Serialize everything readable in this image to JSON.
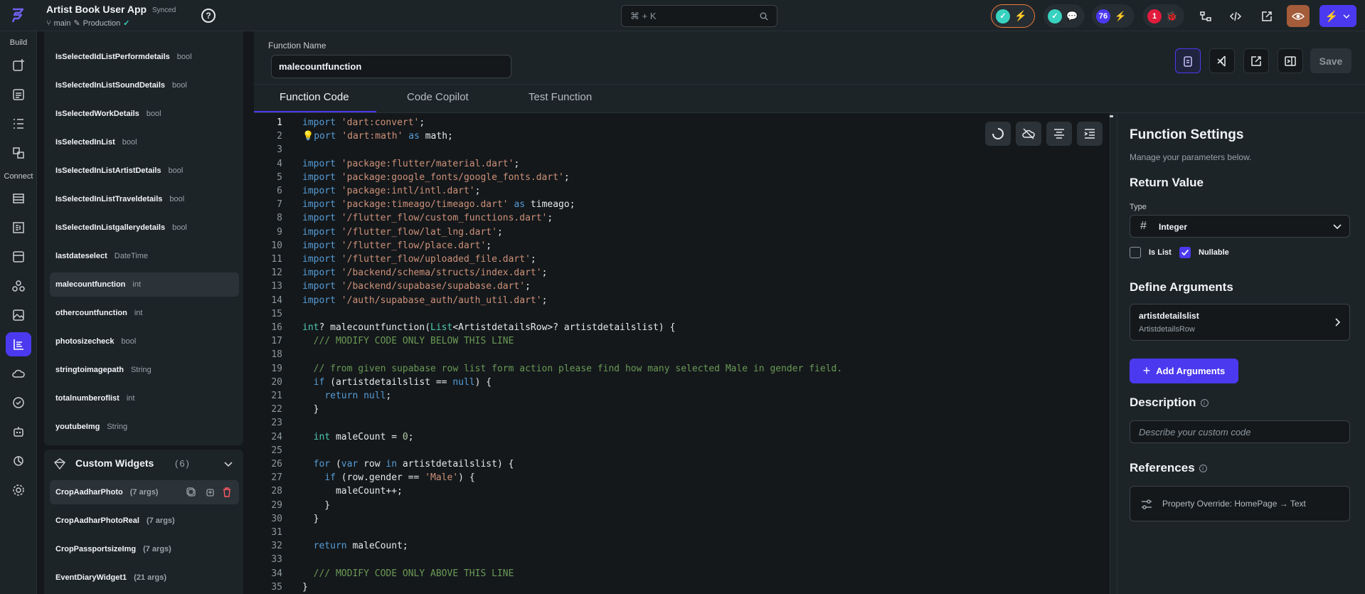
{
  "topbar": {
    "app_title": "Artist Book User App",
    "sync_status": "Synced",
    "branch": "main",
    "environment": "Production",
    "search_hint": "⌘ + K",
    "issue_count": "76",
    "error_count": "1"
  },
  "rail": {
    "build_label": "Build",
    "connect_label": "Connect"
  },
  "left_panel": {
    "items": [
      {
        "name": "IsSelectedIdListPerformdetails",
        "type": "bool"
      },
      {
        "name": "IsSelectedInListSoundDetails",
        "type": "bool"
      },
      {
        "name": "IsSelectedWorkDetails",
        "type": "bool"
      },
      {
        "name": "IsSelectedInList",
        "type": "bool"
      },
      {
        "name": "IsSelectedInListArtistDetails",
        "type": "bool"
      },
      {
        "name": "IsSelectedInListTraveldetails",
        "type": "bool"
      },
      {
        "name": "IsSelectedInListgallerydetails",
        "type": "bool"
      },
      {
        "name": "lastdateselect",
        "type": "DateTime"
      },
      {
        "name": "malecountfunction",
        "type": "int"
      },
      {
        "name": "othercountfunction",
        "type": "int"
      },
      {
        "name": "photosizecheck",
        "type": "bool"
      },
      {
        "name": "stringtoimagepath",
        "type": "String"
      },
      {
        "name": "totalnumberoflist",
        "type": "int"
      },
      {
        "name": "youtubeImg",
        "type": "String"
      }
    ],
    "widgets_title": "Custom Widgets",
    "widgets_count": "(6)",
    "widgets": [
      {
        "name": "CropAadharPhoto",
        "args": "(7 args)"
      },
      {
        "name": "CropAadharPhotoReal",
        "args": "(7 args)"
      },
      {
        "name": "CropPassportsizeImg",
        "args": "(7 args)"
      },
      {
        "name": "EventDiaryWidget1",
        "args": "(21 args)"
      }
    ]
  },
  "header": {
    "function_name_label": "Function Name",
    "function_name_value": "malecountfunction",
    "save_label": "Save"
  },
  "tabs": [
    {
      "label": "Function Code"
    },
    {
      "label": "Code Copilot"
    },
    {
      "label": "Test Function"
    }
  ],
  "code_lines": [
    [
      [
        "kw",
        "import"
      ],
      [
        "t",
        " "
      ],
      [
        "str",
        "'dart:convert'"
      ],
      [
        "t",
        ";"
      ]
    ],
    [
      [
        "t",
        "💡"
      ],
      [
        "kw",
        "port"
      ],
      [
        "t",
        " "
      ],
      [
        "str",
        "'dart:math'"
      ],
      [
        "t",
        " "
      ],
      [
        "kw",
        "as"
      ],
      [
        "t",
        " math;"
      ]
    ],
    [],
    [
      [
        "kw",
        "import"
      ],
      [
        "t",
        " "
      ],
      [
        "str",
        "'package:flutter/material.dart'"
      ],
      [
        "t",
        ";"
      ]
    ],
    [
      [
        "kw",
        "import"
      ],
      [
        "t",
        " "
      ],
      [
        "str",
        "'package:google_fonts/google_fonts.dart'"
      ],
      [
        "t",
        ";"
      ]
    ],
    [
      [
        "kw",
        "import"
      ],
      [
        "t",
        " "
      ],
      [
        "str",
        "'package:intl/intl.dart'"
      ],
      [
        "t",
        ";"
      ]
    ],
    [
      [
        "kw",
        "import"
      ],
      [
        "t",
        " "
      ],
      [
        "str",
        "'package:timeago/timeago.dart'"
      ],
      [
        "t",
        " "
      ],
      [
        "kw",
        "as"
      ],
      [
        "t",
        " timeago;"
      ]
    ],
    [
      [
        "kw",
        "import"
      ],
      [
        "t",
        " "
      ],
      [
        "str",
        "'/flutter_flow/custom_functions.dart'"
      ],
      [
        "t",
        ";"
      ]
    ],
    [
      [
        "kw",
        "import"
      ],
      [
        "t",
        " "
      ],
      [
        "str",
        "'/flutter_flow/lat_lng.dart'"
      ],
      [
        "t",
        ";"
      ]
    ],
    [
      [
        "kw",
        "import"
      ],
      [
        "t",
        " "
      ],
      [
        "str",
        "'/flutter_flow/place.dart'"
      ],
      [
        "t",
        ";"
      ]
    ],
    [
      [
        "kw",
        "import"
      ],
      [
        "t",
        " "
      ],
      [
        "str",
        "'/flutter_flow/uploaded_file.dart'"
      ],
      [
        "t",
        ";"
      ]
    ],
    [
      [
        "kw",
        "import"
      ],
      [
        "t",
        " "
      ],
      [
        "str",
        "'/backend/schema/structs/index.dart'"
      ],
      [
        "t",
        ";"
      ]
    ],
    [
      [
        "kw",
        "import"
      ],
      [
        "t",
        " "
      ],
      [
        "str",
        "'/backend/supabase/supabase.dart'"
      ],
      [
        "t",
        ";"
      ]
    ],
    [
      [
        "kw",
        "import"
      ],
      [
        "t",
        " "
      ],
      [
        "str",
        "'/auth/supabase_auth/auth_util.dart'"
      ],
      [
        "t",
        ";"
      ]
    ],
    [],
    [
      [
        "kw2",
        "int"
      ],
      [
        "t",
        "? malecountfunction("
      ],
      [
        "kw2",
        "List"
      ],
      [
        "t",
        "<ArtistdetailsRow>? artistdetailslist) {"
      ]
    ],
    [
      [
        "t",
        "  "
      ],
      [
        "cm",
        "/// MODIFY CODE ONLY BELOW THIS LINE"
      ]
    ],
    [],
    [
      [
        "t",
        "  "
      ],
      [
        "cm",
        "// from given supabase row list form action please find how many selected Male in gender field."
      ]
    ],
    [
      [
        "t",
        "  "
      ],
      [
        "kw",
        "if"
      ],
      [
        "t",
        " (artistdetailslist == "
      ],
      [
        "kw",
        "null"
      ],
      [
        "t",
        ") {"
      ]
    ],
    [
      [
        "t",
        "    "
      ],
      [
        "kw",
        "return"
      ],
      [
        "t",
        " "
      ],
      [
        "kw",
        "null"
      ],
      [
        "t",
        ";"
      ]
    ],
    [
      [
        "t",
        "  }"
      ]
    ],
    [],
    [
      [
        "t",
        "  "
      ],
      [
        "kw2",
        "int"
      ],
      [
        "t",
        " maleCount = "
      ],
      [
        "num",
        "0"
      ],
      [
        "t",
        ";"
      ]
    ],
    [],
    [
      [
        "t",
        "  "
      ],
      [
        "kw",
        "for"
      ],
      [
        "t",
        " ("
      ],
      [
        "kw",
        "var"
      ],
      [
        "t",
        " row "
      ],
      [
        "kw",
        "in"
      ],
      [
        "t",
        " artistdetailslist) {"
      ]
    ],
    [
      [
        "t",
        "    "
      ],
      [
        "kw",
        "if"
      ],
      [
        "t",
        " (row.gender == "
      ],
      [
        "str",
        "'Male'"
      ],
      [
        "t",
        ") {"
      ]
    ],
    [
      [
        "t",
        "      maleCount++;"
      ]
    ],
    [
      [
        "t",
        "    }"
      ]
    ],
    [
      [
        "t",
        "  }"
      ]
    ],
    [],
    [
      [
        "t",
        "  "
      ],
      [
        "kw",
        "return"
      ],
      [
        "t",
        " maleCount;"
      ]
    ],
    [],
    [
      [
        "t",
        "  "
      ],
      [
        "cm",
        "/// MODIFY CODE ONLY ABOVE THIS LINE"
      ]
    ],
    [
      [
        "t",
        "}"
      ]
    ]
  ],
  "settings": {
    "title": "Function Settings",
    "subtitle": "Manage your parameters below.",
    "return_title": "Return Value",
    "type_label": "Type",
    "type_value": "Integer",
    "is_list_label": "Is List",
    "is_list_checked": false,
    "nullable_label": "Nullable",
    "nullable_checked": true,
    "args_title": "Define Arguments",
    "arg_name": "artistdetailslist",
    "arg_type": "ArtistdetailsRow",
    "add_args_label": "Add Arguments",
    "description_title": "Description",
    "description_placeholder": "Describe your custom code",
    "references_title": "References",
    "reference_text": "Property Override: HomePage → Text"
  },
  "colors": {
    "accent": "#4b39ef",
    "success": "#39d2c0",
    "error": "#ff5963"
  }
}
